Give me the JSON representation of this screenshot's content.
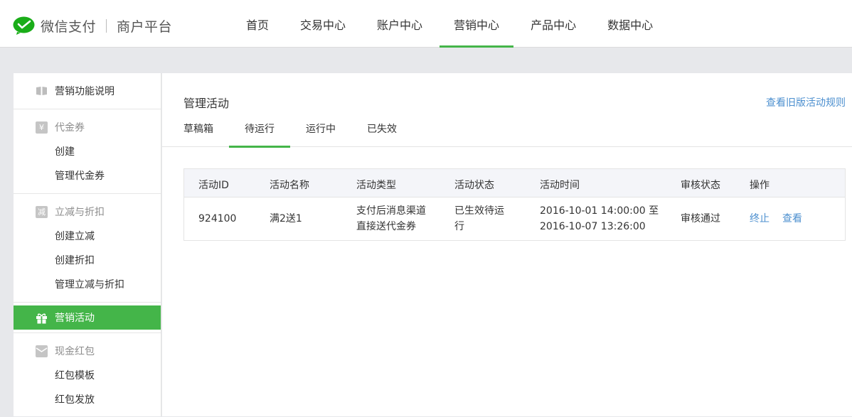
{
  "header": {
    "brand": "微信支付",
    "platform": "商户平台",
    "nav": [
      "首页",
      "交易中心",
      "账户中心",
      "营销中心",
      "产品中心",
      "数据中心"
    ],
    "active_nav": "营销中心",
    "accent_color": "#44b549"
  },
  "sidebar": {
    "intro": "营销功能说明",
    "voucher": {
      "title": "代金券",
      "items": [
        "创建",
        "管理代金券"
      ]
    },
    "discount": {
      "title": "立减与折扣",
      "items": [
        "创建立减",
        "创建折扣",
        "管理立减与折扣"
      ]
    },
    "campaign": "营销活动",
    "redpacket": {
      "title": "现金红包",
      "items": [
        "红包模板",
        "红包发放"
      ]
    },
    "icons": [
      "book-icon",
      "voucher-icon",
      "discount-icon",
      "gift-icon",
      "redpacket-icon"
    ]
  },
  "main": {
    "title": "管理活动",
    "old_rules_link": "查看旧版活动规则",
    "tabs": [
      "草稿箱",
      "待运行",
      "运行中",
      "已失效"
    ],
    "active_tab": "待运行",
    "table": {
      "columns": [
        "活动ID",
        "活动名称",
        "活动类型",
        "活动状态",
        "活动时间",
        "审核状态",
        "操作"
      ],
      "rows": [
        {
          "id": "924100",
          "name": "满2送1",
          "type_line1": "支付后消息渠道",
          "type_line2": "直接送代金券",
          "status_line1": "已生效待运",
          "status_line2": "行",
          "time_line1": "2016-10-01 14:00:00 至",
          "time_line2": "2016-10-07 13:26:00",
          "review": "审核通过",
          "action_stop": "终止",
          "action_view": "查看"
        }
      ]
    }
  }
}
